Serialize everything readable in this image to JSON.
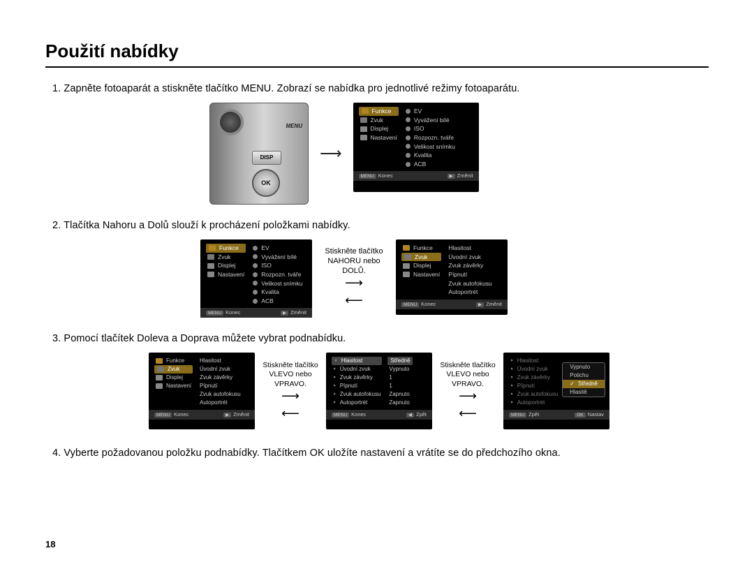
{
  "title": "Použití nabídky",
  "pagenum": "18",
  "steps": {
    "s1": "1. Zapněte fotoaparát a stiskněte tlačítko MENU. Zobrazí se nabídka pro jednotlivé režimy fotoaparátu.",
    "s2": "2. Tlačítka Nahoru a Dolů slouží k procházení položkami nabídky.",
    "s3": "3. Pomocí tlačítek Doleva a Doprava můžete vybrat podnabídku.",
    "s4": "4. Vyberte požadovanou položku podnabídky. Tlačítkem OK uložíte nastavení a vrátíte se do předchozího okna."
  },
  "camera": {
    "menu": "MENU",
    "disp": "DISP",
    "ok": "OK"
  },
  "hint": {
    "updown": "Stiskněte tlačítko NAHORU nebo DOLŮ.",
    "leftrightA": "Stiskněte tlačítko VLEVO nebo VPRAVO.",
    "leftrightB": "Stiskněte tlačítko VLEVO nebo VPRAVO."
  },
  "foot": {
    "menu": "MENU",
    "konec": "Konec",
    "play": "▶",
    "zmenit": "Změnit",
    "back": "◀",
    "zpet": "Zpět",
    "ok": "OK",
    "nastav": "Nastav"
  },
  "leftMenu": {
    "i0": "Funkce",
    "i1": "Zvuk",
    "i2": "Displej",
    "i3": "Nastavení"
  },
  "rightFunkce": {
    "r0": "EV",
    "r1": "Vyvážení bílé",
    "r2": "ISO",
    "r3": "Rozpozn. tváře",
    "r4": "Velikost snímku",
    "r5": "Kvalita",
    "r6": "ACB"
  },
  "rightZvuk": {
    "r0": "Hlasitost",
    "r1": "Úvodní zvuk",
    "r2": "Zvuk závěrky",
    "r3": "Pípnutí",
    "r4": "Zvuk autofokusu",
    "r5": "Autoportrét"
  },
  "zvukVals": {
    "v0": "Středně",
    "v1": "Vypnuto",
    "v2": "1",
    "v3": "1",
    "v4": "Zapnuto",
    "v5": "Zapnuto"
  },
  "popup": {
    "p0": "Vypnuto",
    "p1": "Potichu",
    "p2": "Středně",
    "p3": "Hlasitě"
  }
}
